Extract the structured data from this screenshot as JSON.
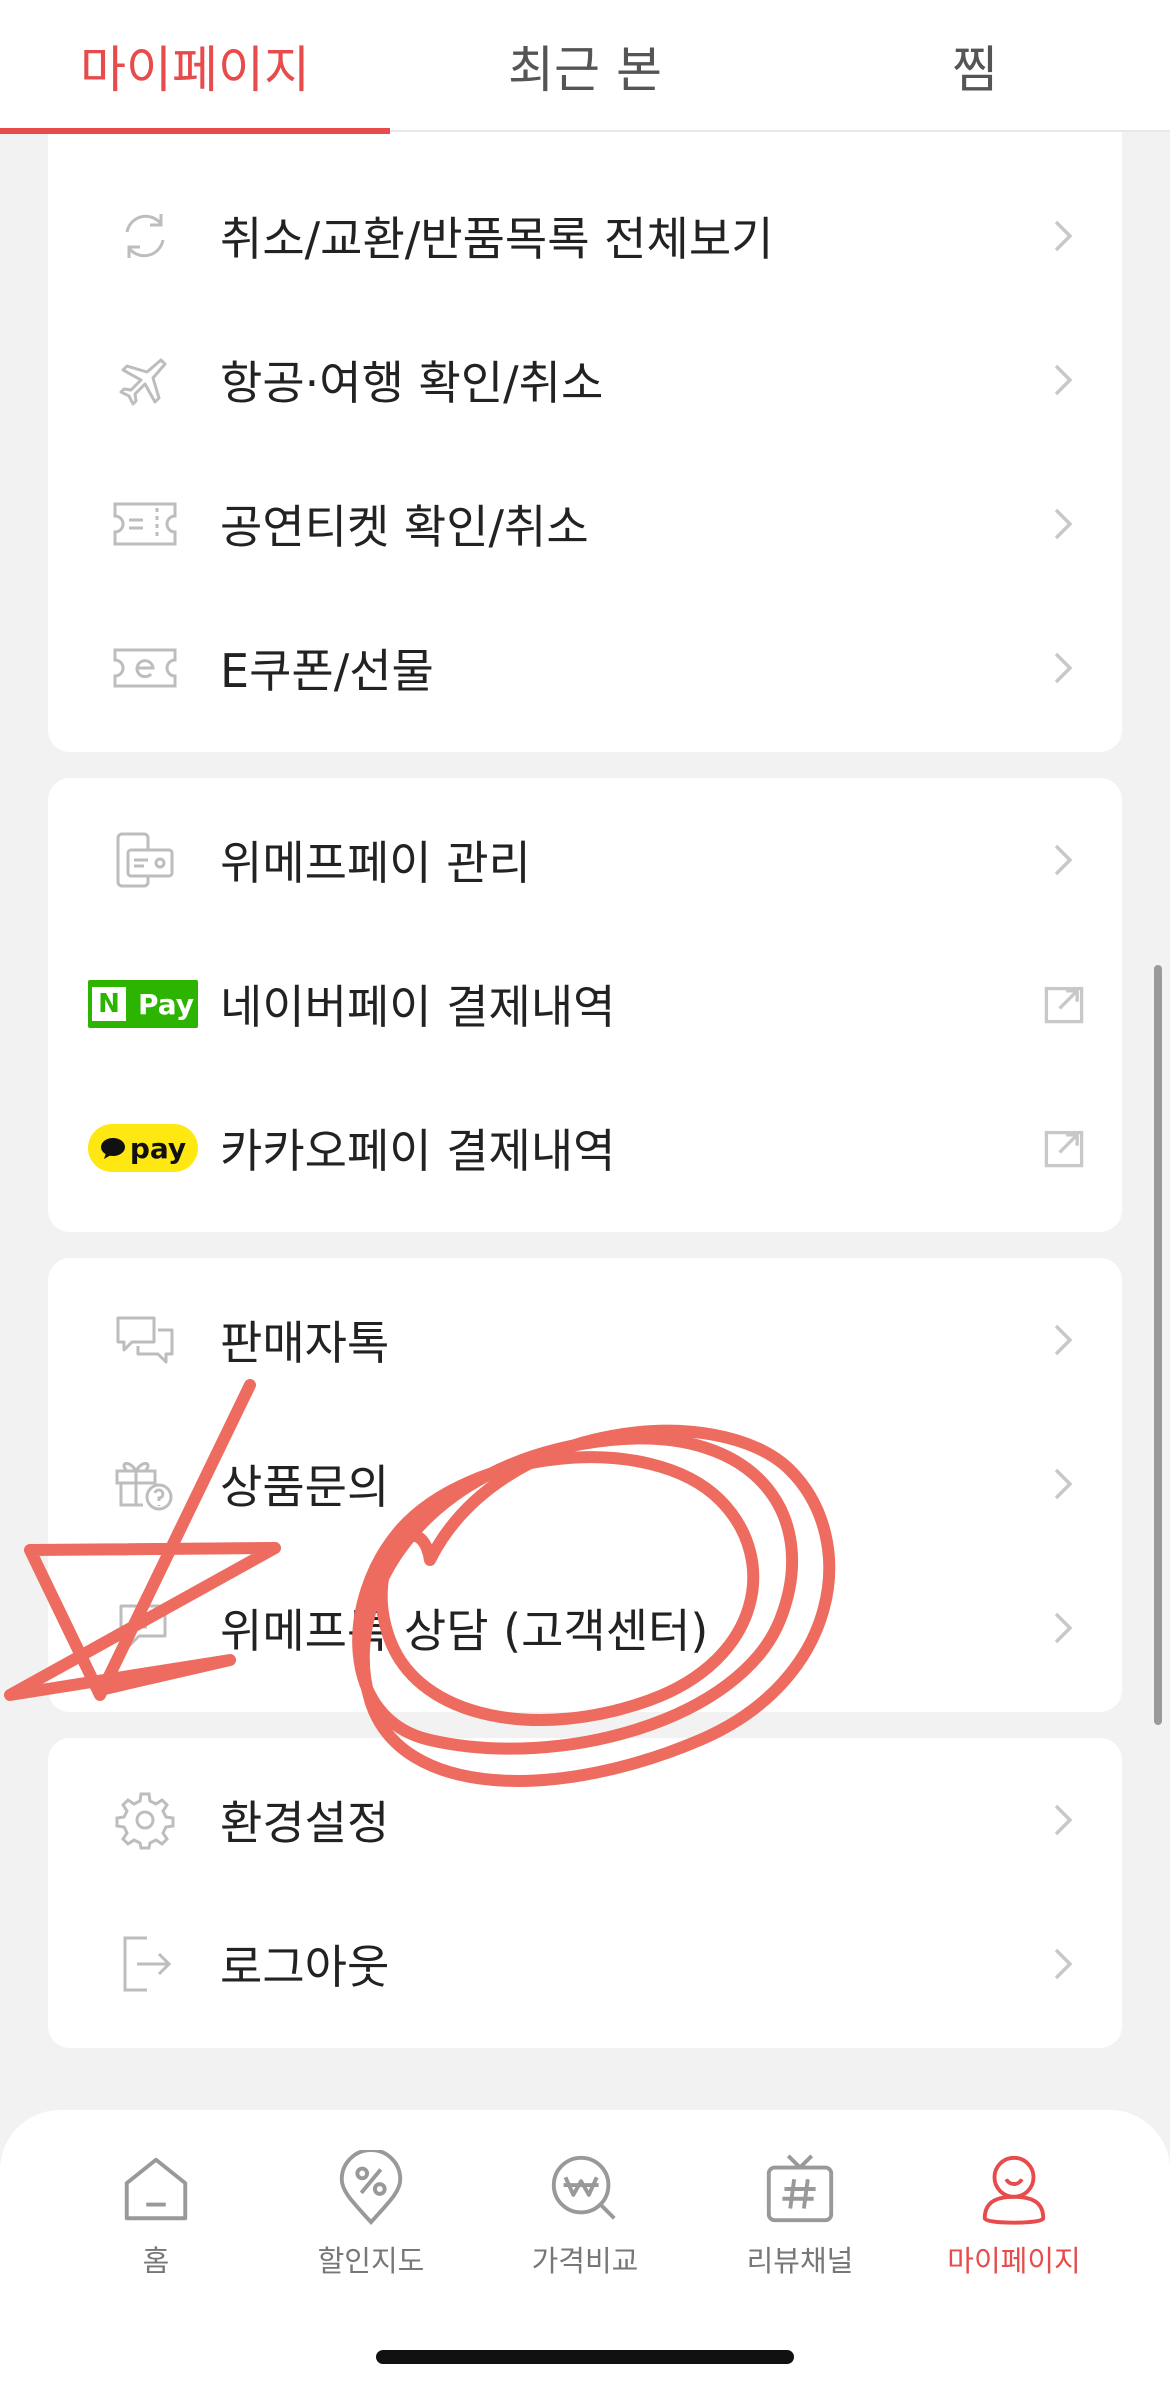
{
  "top_tabs": [
    {
      "label": "마이페이지",
      "active": true
    },
    {
      "label": "최근 본",
      "active": false
    },
    {
      "label": "찜",
      "active": false
    }
  ],
  "card1": {
    "items": [
      {
        "icon": "exchange-icon",
        "label": "취소/교환/반품목록 전체보기",
        "action": "chevron-right-icon"
      },
      {
        "icon": "airplane-icon",
        "label": "항공·여행 확인/취소",
        "action": "chevron-right-icon"
      },
      {
        "icon": "ticket-icon",
        "label": "공연티켓 확인/취소",
        "action": "chevron-right-icon"
      },
      {
        "icon": "ecoupon-icon",
        "label": "E쿠폰/선물",
        "action": "chevron-right-icon"
      }
    ]
  },
  "card2": {
    "items": [
      {
        "icon": "wallet-card-icon",
        "label": "위메프페이 관리",
        "action": "chevron-right-icon"
      },
      {
        "icon": "naverpay-logo",
        "label": "네이버페이 결제내역",
        "action": "external-link-icon",
        "badge": {
          "n": "N",
          "text": "Pay"
        }
      },
      {
        "icon": "kakaopay-logo",
        "label": "카카오페이 결제내역",
        "action": "external-link-icon",
        "badge": {
          "text": "pay"
        }
      }
    ]
  },
  "card3": {
    "items": [
      {
        "icon": "chat-bubbles-icon",
        "label": "판매자톡",
        "action": "chevron-right-icon"
      },
      {
        "icon": "gift-question-icon",
        "label": "상품문의",
        "action": "chevron-right-icon"
      },
      {
        "icon": "headset-chat-icon",
        "label": "위메프톡 상담 (고객센터)",
        "action": "chevron-right-icon"
      }
    ]
  },
  "card4": {
    "items": [
      {
        "icon": "gear-icon",
        "label": "환경설정",
        "action": "chevron-right-icon"
      },
      {
        "icon": "logout-icon",
        "label": "로그아웃",
        "action": "chevron-right-icon"
      }
    ]
  },
  "bottom_nav": [
    {
      "icon": "home-icon",
      "label": "홈",
      "active": false
    },
    {
      "icon": "discount-map-icon",
      "label": "할인지도",
      "active": false
    },
    {
      "icon": "price-compare-icon",
      "label": "가격비교",
      "active": false
    },
    {
      "icon": "review-channel-icon",
      "label": "리뷰채널",
      "active": false
    },
    {
      "icon": "mypage-icon",
      "label": "마이페이지",
      "active": true
    }
  ],
  "colors": {
    "accent": "#e84b4b",
    "annotation": "#ee6b5f",
    "naverpay": "#2db400",
    "kakaopay": "#ffe812"
  }
}
